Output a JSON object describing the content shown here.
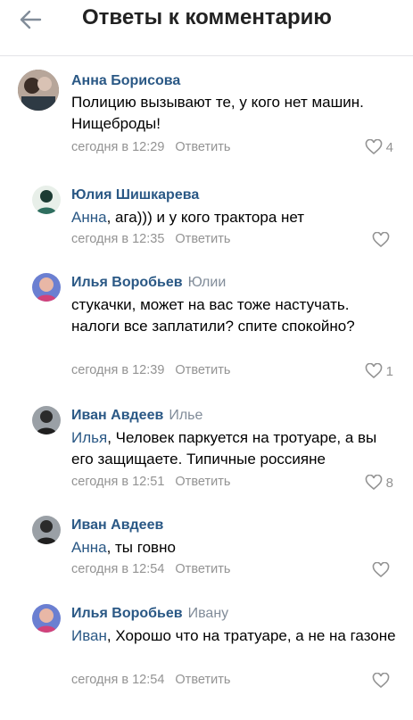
{
  "header": {
    "title": "Ответы к комментарию",
    "back_icon": "arrow-left-icon"
  },
  "comments": [
    {
      "name": "Анна Борисова",
      "reply_to": "",
      "mention": "",
      "text": "Полицию вызывают те, у кого нет машин. Нищеброды!",
      "time": "сегодня в 12:29",
      "reply_label": "Ответить",
      "likes": "4"
    },
    {
      "name": "Юлия Шишкарева",
      "reply_to": "",
      "mention": "Анна",
      "text": ", ага))) и у кого трактора нет",
      "time": "сегодня в 12:35",
      "reply_label": "Ответить",
      "likes": ""
    },
    {
      "name": "Илья Воробьев",
      "reply_to": "Юлии",
      "mention": "",
      "text": "стукачки, может на вас тоже настучать. налоги все заплатили? спите спокойно?",
      "time": "сегодня в 12:39",
      "reply_label": "Ответить",
      "likes": "1"
    },
    {
      "name": "Иван Авдеев",
      "reply_to": "Илье",
      "mention": "Илья",
      "text": ", Человек паркуется на тротуаре, а вы его защищаете. Типичные россияне",
      "time": "сегодня в 12:51",
      "reply_label": "Ответить",
      "likes": "8"
    },
    {
      "name": "Иван Авдеев",
      "reply_to": "",
      "mention": "Анна",
      "text": ", ты говно",
      "time": "сегодня в 12:54",
      "reply_label": "Ответить",
      "likes": ""
    },
    {
      "name": "Илья Воробьев",
      "reply_to": "Ивану",
      "mention": "Иван",
      "text": ", Хорошо что на тратуаре, а не на газоне",
      "time": "сегодня в 12:54",
      "reply_label": "Ответить",
      "likes": ""
    }
  ],
  "colors": {
    "link": "#2a5885",
    "meta": "#939393",
    "divider": "#e3e4e8"
  }
}
